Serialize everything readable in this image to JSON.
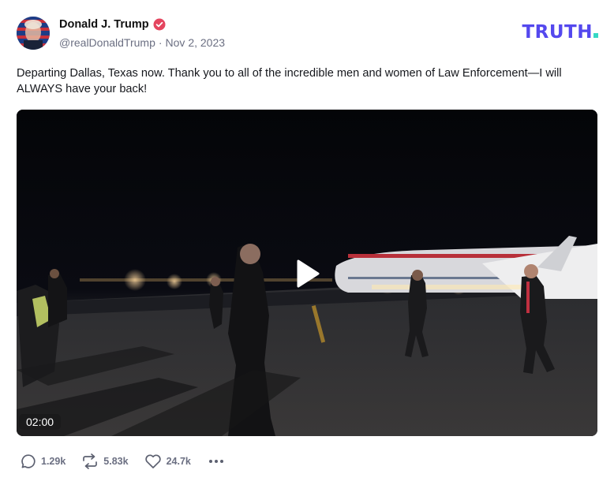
{
  "post": {
    "display_name": "Donald J. Trump",
    "handle": "@realDonaldTrump",
    "separator": "·",
    "date": "Nov 2, 2023",
    "text": "Departing Dallas, Texas now. Thank you to all of the incredible men and women of Law Enforcement—I will ALWAYS have your back!"
  },
  "brand": {
    "logo_text": "TRUTH",
    "logo_color": "#5448EE",
    "logo_dot_color": "#36D8C4",
    "verified_color": "#E4455F"
  },
  "video": {
    "duration": "02:00",
    "play_icon": "play-icon"
  },
  "actions": {
    "replies": "1.29k",
    "retruths": "5.83k",
    "likes": "24.7k",
    "icons": [
      "reply-icon",
      "retruth-icon",
      "like-icon",
      "more-icon"
    ]
  }
}
